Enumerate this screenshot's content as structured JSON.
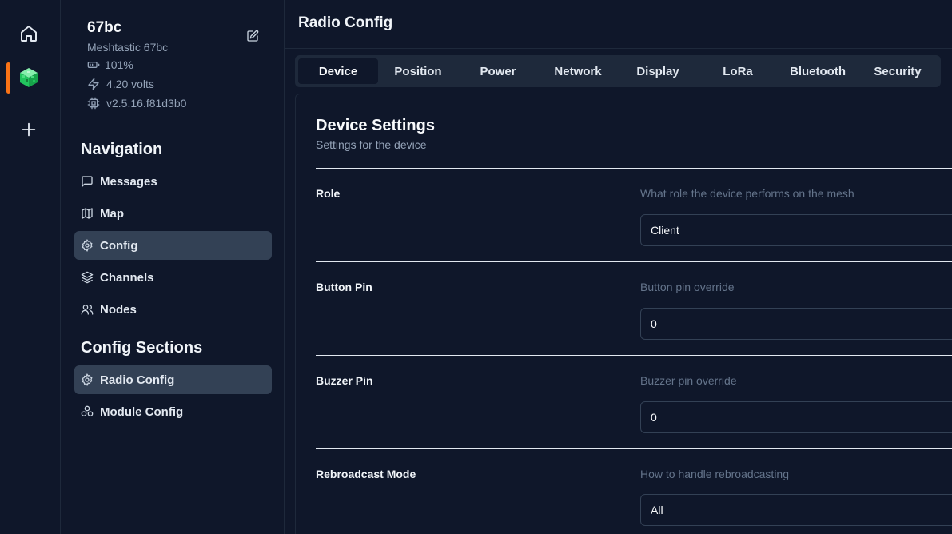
{
  "rail": {
    "home_icon": "home-icon",
    "node_icon": "node-cube-icon",
    "add_icon": "plus-icon",
    "indicator_color": "#f97316"
  },
  "device": {
    "short_name": "67bc",
    "long_name": "Meshtastic 67bc",
    "battery": "101%",
    "voltage": "4.20 volts",
    "firmware": "v2.5.16.f81d3b0"
  },
  "navigation": {
    "title": "Navigation",
    "items": [
      {
        "label": "Messages",
        "icon": "message-square-icon",
        "active": false
      },
      {
        "label": "Map",
        "icon": "map-icon",
        "active": false
      },
      {
        "label": "Config",
        "icon": "gear-icon",
        "active": true
      },
      {
        "label": "Channels",
        "icon": "layers-icon",
        "active": false
      },
      {
        "label": "Nodes",
        "icon": "users-icon",
        "active": false
      }
    ]
  },
  "config_sections": {
    "title": "Config Sections",
    "items": [
      {
        "label": "Radio Config",
        "icon": "gear-icon",
        "active": true
      },
      {
        "label": "Module Config",
        "icon": "boxes-icon",
        "active": false
      }
    ]
  },
  "main": {
    "title": "Radio Config",
    "tabs": [
      {
        "label": "Device",
        "active": true
      },
      {
        "label": "Position",
        "active": false
      },
      {
        "label": "Power",
        "active": false
      },
      {
        "label": "Network",
        "active": false
      },
      {
        "label": "Display",
        "active": false
      },
      {
        "label": "LoRa",
        "active": false
      },
      {
        "label": "Bluetooth",
        "active": false
      },
      {
        "label": "Security",
        "active": false
      }
    ],
    "panel": {
      "title": "Device Settings",
      "subtitle": "Settings for the device",
      "fields": [
        {
          "label": "Role",
          "description": "What role the device performs on the mesh",
          "value": "Client"
        },
        {
          "label": "Button Pin",
          "description": "Button pin override",
          "value": "0"
        },
        {
          "label": "Buzzer Pin",
          "description": "Buzzer pin override",
          "value": "0"
        },
        {
          "label": "Rebroadcast Mode",
          "description": "How to handle rebroadcasting",
          "value": "All"
        }
      ]
    }
  }
}
